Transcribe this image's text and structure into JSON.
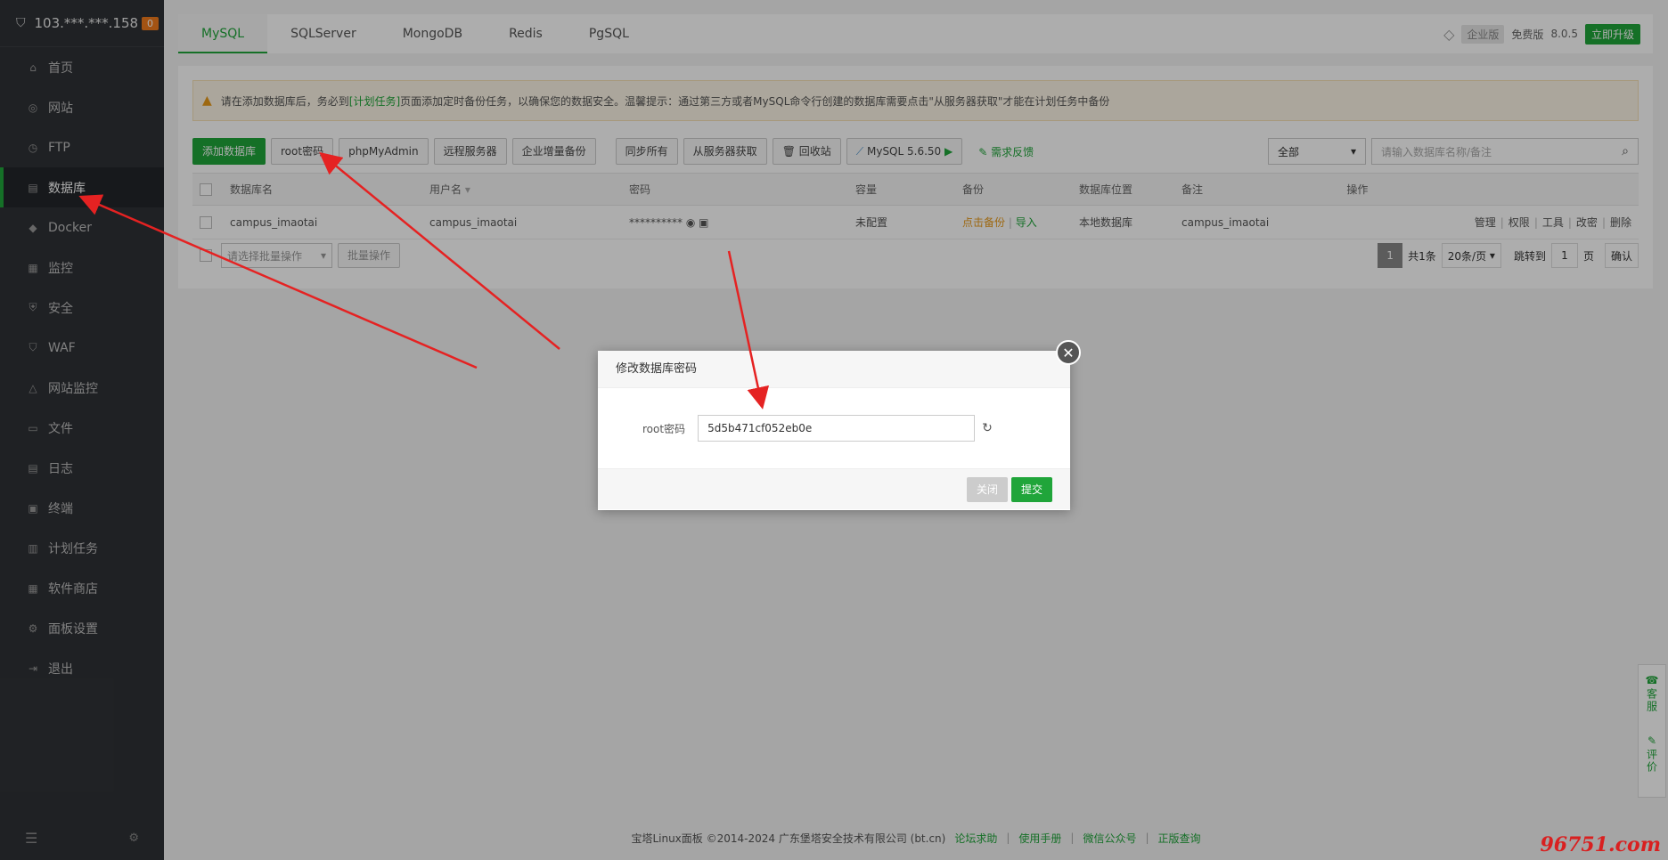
{
  "server": {
    "ip": "103.***.***.158",
    "badge": "0"
  },
  "sidebar": {
    "items": [
      {
        "label": "首页",
        "icon": "home-icon",
        "glyph": "⌂"
      },
      {
        "label": "网站",
        "icon": "globe-icon",
        "glyph": "◎"
      },
      {
        "label": "FTP",
        "icon": "ftp-icon",
        "glyph": "◷"
      },
      {
        "label": "数据库",
        "icon": "database-icon",
        "glyph": "▤"
      },
      {
        "label": "Docker",
        "icon": "docker-icon",
        "glyph": "◆"
      },
      {
        "label": "监控",
        "icon": "monitor-icon",
        "glyph": "▦"
      },
      {
        "label": "安全",
        "icon": "shield-icon",
        "glyph": "⛨"
      },
      {
        "label": "WAF",
        "icon": "waf-icon",
        "glyph": "⛉"
      },
      {
        "label": "网站监控",
        "icon": "chart-icon",
        "glyph": "△"
      },
      {
        "label": "文件",
        "icon": "folder-icon",
        "glyph": "▭"
      },
      {
        "label": "日志",
        "icon": "log-icon",
        "glyph": "▤"
      },
      {
        "label": "终端",
        "icon": "terminal-icon",
        "glyph": "▣"
      },
      {
        "label": "计划任务",
        "icon": "calendar-icon",
        "glyph": "▥"
      },
      {
        "label": "软件商店",
        "icon": "apps-icon",
        "glyph": "▦"
      },
      {
        "label": "面板设置",
        "icon": "gear-icon",
        "glyph": "⚙"
      },
      {
        "label": "退出",
        "icon": "logout-icon",
        "glyph": "⇥"
      }
    ]
  },
  "tabs": [
    "MySQL",
    "SQLServer",
    "MongoDB",
    "Redis",
    "PgSQL"
  ],
  "topright": {
    "enterprise": "企业版",
    "free": "免费版",
    "version": "8.0.5",
    "upgrade": "立即升级"
  },
  "notice": {
    "pre": "请在添加数据库后，务必到",
    "link": "[计划任务]",
    "post": "页面添加定时备份任务，以确保您的数据安全。温馨提示：通过第三方或者MySQL命令行创建的数据库需要点击\"从服务器获取\"才能在计划任务中备份"
  },
  "toolbar": {
    "add_db": "添加数据库",
    "root_pwd": "root密码",
    "phpmyadmin": "phpMyAdmin",
    "remote": "远程服务器",
    "incr_backup": "企业增量备份",
    "sync_all": "同步所有",
    "from_server": "从服务器获取",
    "recycle": "回收站",
    "mysql_version": "MySQL 5.6.50",
    "feedback": "需求反馈",
    "filter": "全部",
    "search_placeholder": "请输入数据库名称/备注"
  },
  "table": {
    "headers": [
      "数据库名",
      "用户名",
      "密码",
      "容量",
      "备份",
      "数据库位置",
      "备注",
      "操作"
    ],
    "rows": [
      {
        "name": "campus_imaotai",
        "user": "campus_imaotai",
        "password": "**********",
        "capacity": "未配置",
        "backup": "点击备份",
        "import": "导入",
        "location": "本地数据库",
        "note": "campus_imaotai",
        "ops": [
          "管理",
          "权限",
          "工具",
          "改密",
          "删除"
        ]
      }
    ]
  },
  "batch": {
    "placeholder": "请选择批量操作",
    "button": "批量操作"
  },
  "pager": {
    "current": "1",
    "total": "共1条",
    "per_page": "20条/页",
    "goto": "跳转到",
    "goto_value": "1",
    "page": "页",
    "confirm": "确认"
  },
  "dialog": {
    "title": "修改数据库密码",
    "label": "root密码",
    "value": "5d5b471cf052eb0e",
    "close": "关闭",
    "submit": "提交"
  },
  "footer": {
    "copyright": "宝塔Linux面板 ©2014-2024 广东堡塔安全技术有限公司 (bt.cn)",
    "links": [
      "论坛求助",
      "使用手册",
      "微信公众号",
      "正版查询"
    ]
  },
  "float": {
    "service": "客服",
    "rate": "评价"
  },
  "watermark": "96751.com",
  "colors": {
    "accent": "#20a53a",
    "sidebar_bg": "#2f3236",
    "warn": "#e89a1a",
    "arrow": "#e52222"
  }
}
